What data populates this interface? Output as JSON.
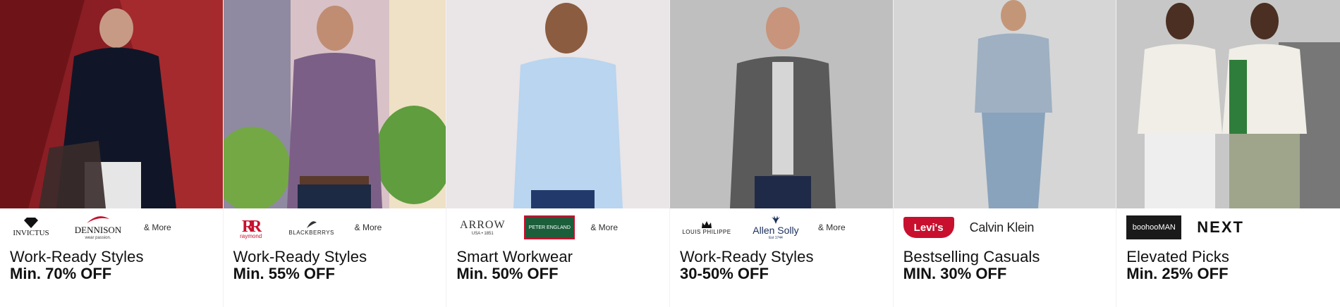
{
  "cards": [
    {
      "brands": [
        "INVICTUS",
        "DENNISON"
      ],
      "brand_taglines": [
        "",
        "wear passion."
      ],
      "more": "& More",
      "title": "Work-Ready Styles",
      "offer": "Min. 70% OFF",
      "colors": {
        "bg": "#8c1f24",
        "accent": "#b32a2e"
      }
    },
    {
      "brands": [
        "raymond",
        "BLACKBERRYS"
      ],
      "more": "& More",
      "title": "Work-Ready Styles",
      "offer": "Min. 55% OFF",
      "colors": {
        "bg": "#d9c7c8",
        "accent": "#7e5d85"
      }
    },
    {
      "brands": [
        "ARROW",
        "PETER ENGLAND"
      ],
      "brand_taglines": [
        "USA • 1851",
        ""
      ],
      "more": "& More",
      "title": "Smart Workwear",
      "offer": "Min. 50% OFF",
      "colors": {
        "bg": "#ece7e8",
        "accent": "#b7d3ec"
      }
    },
    {
      "brands": [
        "LOUIS PHILIPPE",
        "Allen Solly"
      ],
      "brand_taglines": [
        "",
        "Est 1744"
      ],
      "more": "& More",
      "title": "Work-Ready Styles",
      "offer": "30-50% OFF",
      "colors": {
        "bg": "#bebebe",
        "accent": "#5a5a5a"
      }
    },
    {
      "brands": [
        "Levi's",
        "Calvin Klein"
      ],
      "title": "Bestselling Casuals",
      "offer": "MIN. 30% OFF",
      "colors": {
        "bg": "#d8d8d8",
        "accent": "#8ea2b6"
      }
    },
    {
      "brands": [
        "boohooMAN",
        "NEXT"
      ],
      "title": "Elevated Picks",
      "offer": "Min. 25% OFF",
      "colors": {
        "bg": "#c8c8c8",
        "accent": "#2f7d3b"
      }
    }
  ]
}
